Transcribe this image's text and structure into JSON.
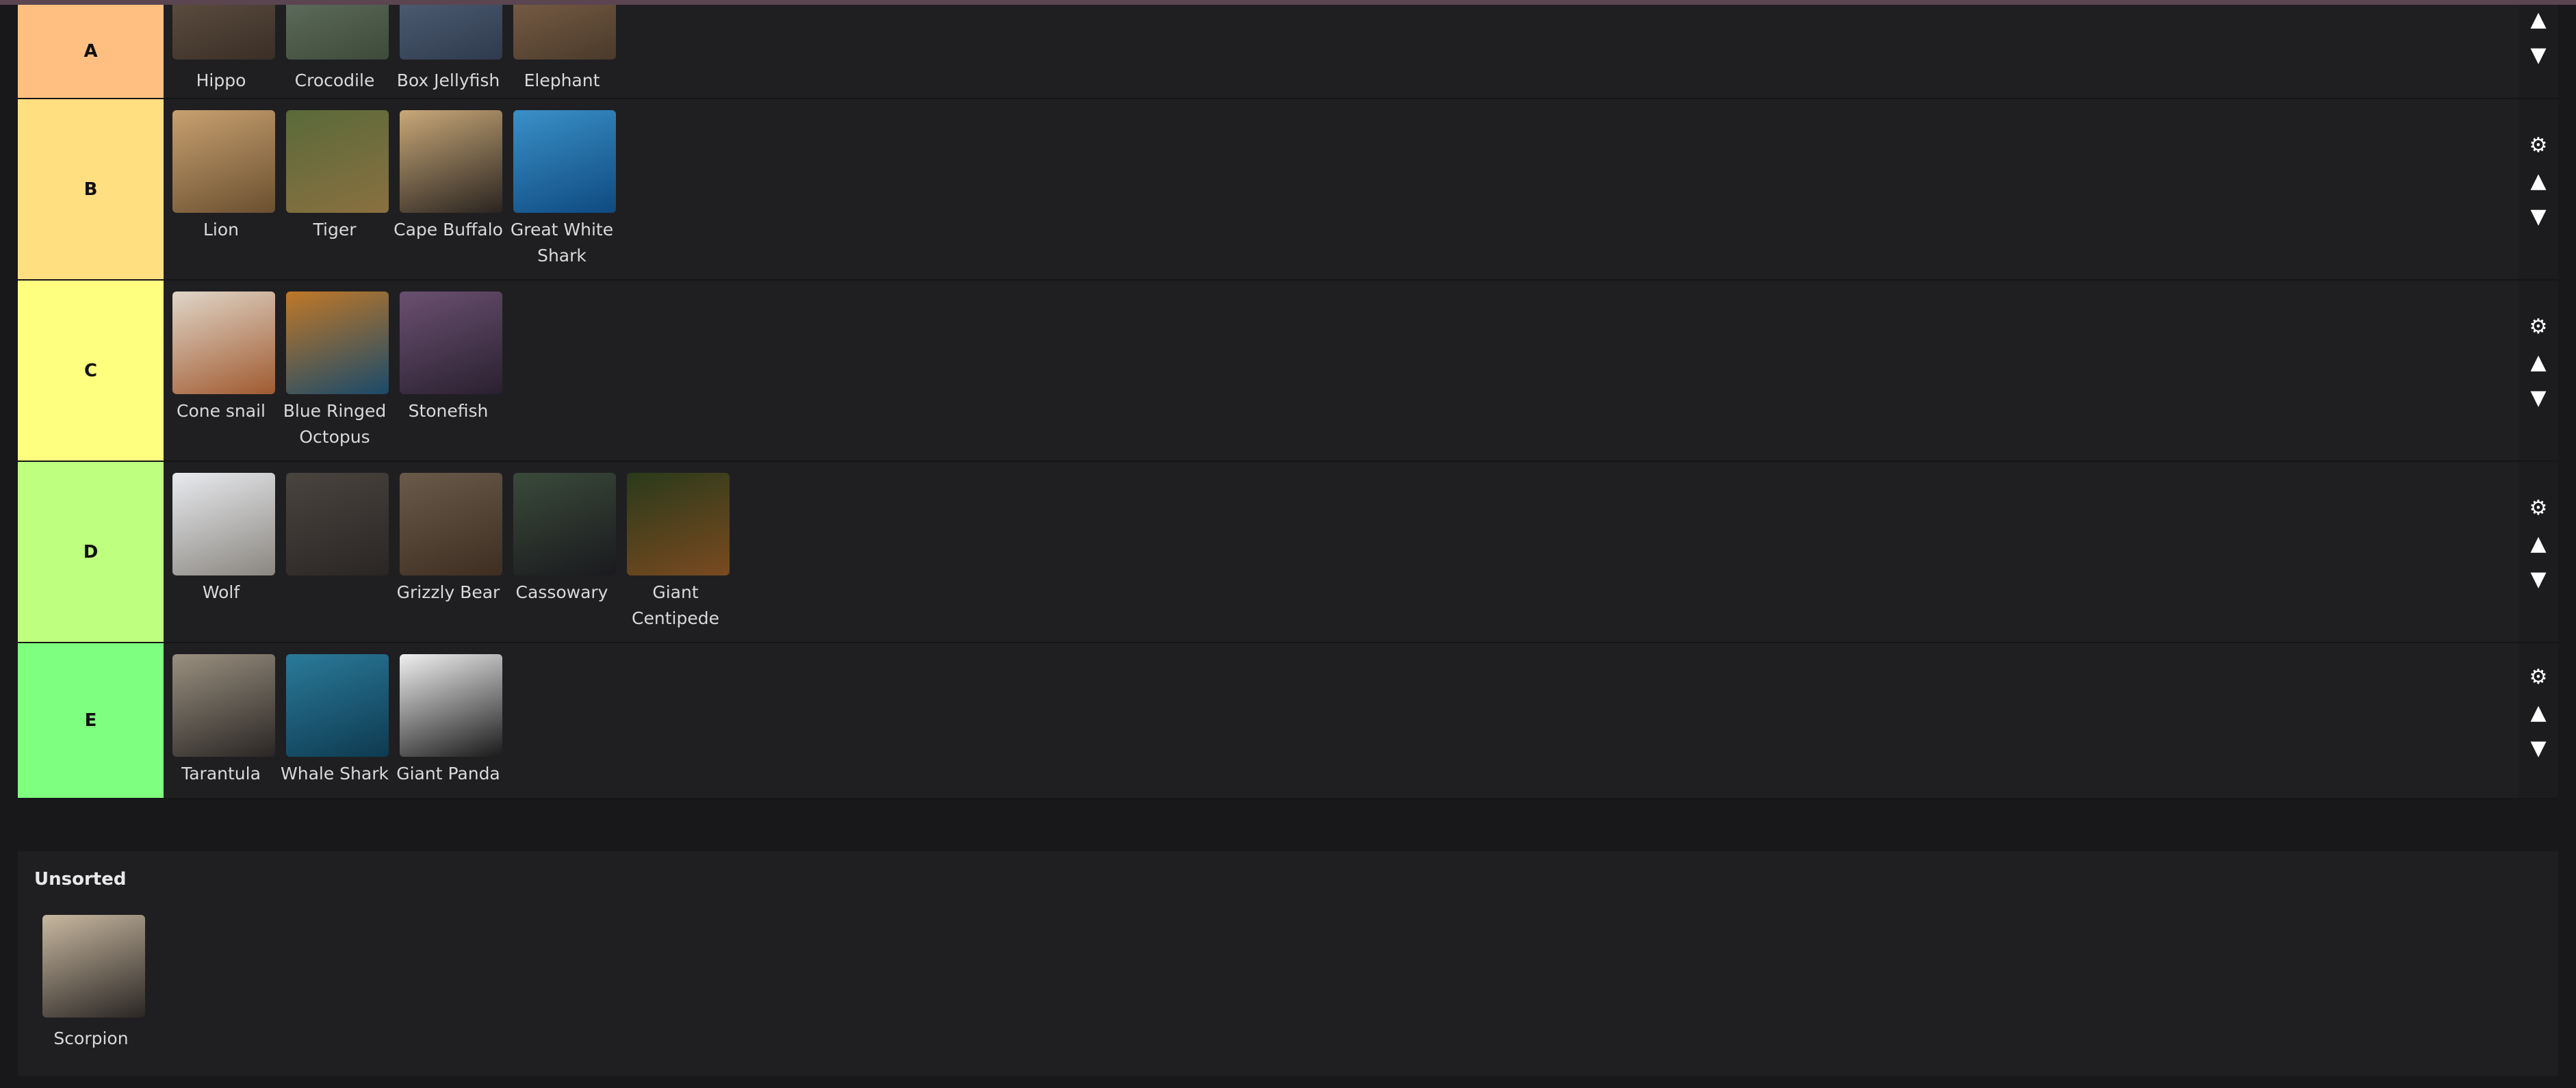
{
  "tiers": [
    {
      "label": "A",
      "color": "#ffbf80",
      "items": [
        {
          "name": "Hippo",
          "icon": "hippo-photo",
          "bg": [
            "#6a5a4a",
            "#3a2e26"
          ]
        },
        {
          "name": "Crocodile",
          "icon": "crocodile-photo",
          "bg": [
            "#6a7a6a",
            "#3e4a3a"
          ]
        },
        {
          "name": "Box Jellyfish",
          "icon": "jellyfish-photo",
          "bg": [
            "#5a6a80",
            "#2e3a4e"
          ]
        },
        {
          "name": "Elephant",
          "icon": "elephant-photo",
          "bg": [
            "#8a6a50",
            "#4a3a2a"
          ]
        }
      ]
    },
    {
      "label": "B",
      "color": "#ffdf80",
      "items": [
        {
          "name": "Lion",
          "icon": "lion-photo",
          "bg": [
            "#c8a070",
            "#6a5030"
          ]
        },
        {
          "name": "Tiger",
          "icon": "tiger-photo",
          "bg": [
            "#5a6a3a",
            "#8a7040"
          ]
        },
        {
          "name": "Cape Buffalo",
          "icon": "buffalo-photo",
          "bg": [
            "#c8a878",
            "#2a2420"
          ]
        },
        {
          "name": "Great White Shark",
          "icon": "shark-photo",
          "bg": [
            "#3a90c8",
            "#0e4a80"
          ]
        }
      ]
    },
    {
      "label": "C",
      "color": "#ffff7f",
      "items": [
        {
          "name": "Cone snail",
          "icon": "cone-snail-photo",
          "bg": [
            "#e0d6c8",
            "#a05a30"
          ]
        },
        {
          "name": "Blue Ringed Octopus",
          "icon": "octopus-photo",
          "bg": [
            "#c07828",
            "#1a4a6a"
          ]
        },
        {
          "name": "Stonefish",
          "icon": "stonefish-photo",
          "bg": [
            "#6a5070",
            "#2a2030"
          ]
        }
      ]
    },
    {
      "label": "D",
      "color": "#bfff7f",
      "items": [
        {
          "name": "Wolf",
          "icon": "wolf-photo",
          "bg": [
            "#e8eaee",
            "#8a8680"
          ]
        },
        {
          "name": "",
          "icon": "scorpion-dragging-photo",
          "bg": [
            "#4a4440",
            "#2a2624"
          ]
        },
        {
          "name": "Grizzly Bear",
          "icon": "bear-photo",
          "bg": [
            "#6a5a4a",
            "#3e2e22"
          ]
        },
        {
          "name": "Cassowary",
          "icon": "cassowary-photo",
          "bg": [
            "#3a4a3a",
            "#1a1a1e"
          ]
        },
        {
          "name": "Giant Centipede",
          "icon": "centipede-photo",
          "bg": [
            "#2a3a1a",
            "#7a4a20"
          ]
        }
      ]
    },
    {
      "label": "E",
      "color": "#7fff7f",
      "items": [
        {
          "name": "Tarantula",
          "icon": "tarantula-photo",
          "bg": [
            "#9a9080",
            "#2a2624"
          ]
        },
        {
          "name": "Whale Shark",
          "icon": "whale-shark-photo",
          "bg": [
            "#2a7a9a",
            "#0e3a50"
          ]
        },
        {
          "name": "Giant Panda",
          "icon": "panda-photo",
          "bg": [
            "#f0f0f0",
            "#1a1a1a"
          ]
        }
      ]
    }
  ],
  "controls": {
    "settings_icon": "gear-icon",
    "up_icon": "arrow-up-icon",
    "down_icon": "arrow-down-icon",
    "gear": "⚙",
    "up": "▲",
    "down": "▼"
  },
  "unsorted": {
    "title": "Unsorted",
    "items": [
      {
        "name": "Scorpion",
        "icon": "scorpion-photo",
        "bg": [
          "#c8b8a0",
          "#2a2624"
        ]
      }
    ]
  }
}
